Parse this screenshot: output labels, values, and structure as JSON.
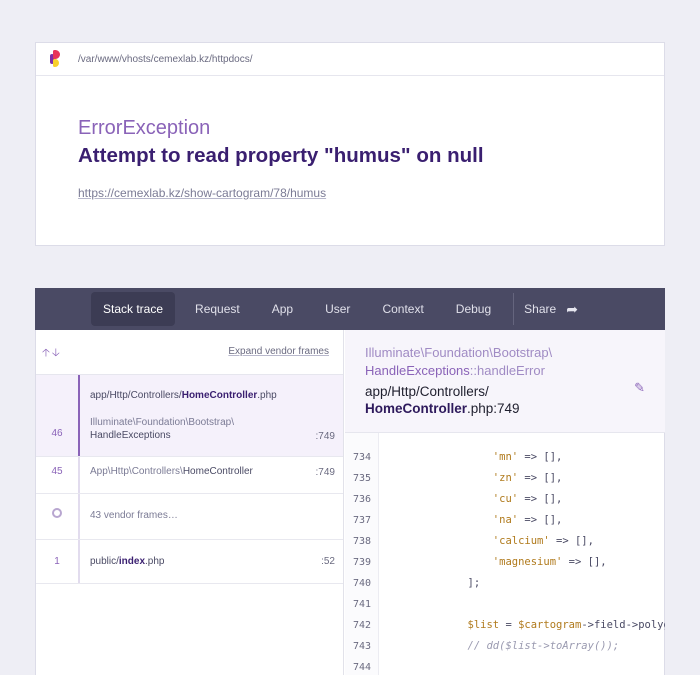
{
  "header": {
    "path": "/var/www/vhosts/cemexlab.kz/httpdocs/"
  },
  "exception": {
    "class": "ErrorException",
    "message": "Attempt to read property \"humus\" on null",
    "url": "https://cemexlab.kz/show-cartogram/78/humus"
  },
  "nav": {
    "items": [
      "Stack trace",
      "Request",
      "App",
      "User",
      "Context",
      "Debug"
    ],
    "active": "Stack trace",
    "share": "Share"
  },
  "stack": {
    "expand_label": "Expand vendor frames",
    "frames": [
      {
        "num": "46",
        "file_prefix": "app/Http/Controllers/",
        "file_strong": "HomeController",
        "file_ext": ".php",
        "sub_line1": "Illuminate\\Foundation\\Bootstrap\\",
        "sub_line2": "HandleExceptions",
        "line": ":749"
      },
      {
        "num": "45",
        "file_prefix": "App\\Http\\Controllers\\",
        "file_strong": "HomeController",
        "line": ":749"
      },
      {
        "vendor_label": "43 vendor frames…"
      },
      {
        "num": "1",
        "file_prefix": "public/",
        "file_strong": "index",
        "file_ext": ".php",
        "line": ":52"
      }
    ]
  },
  "code_header": {
    "class_line1": "Illuminate\\Foundation\\Bootstrap\\",
    "class_line2_a": "HandleExceptions",
    "class_line2_b": "::handleError",
    "file_line1": "app/Http/Controllers/",
    "file_strong": "HomeController",
    "file_ext": ".php:749"
  },
  "code": {
    "lines": [
      {
        "n": "734",
        "indent": "            ",
        "str": "'mn'",
        "rest": " => [],"
      },
      {
        "n": "735",
        "indent": "            ",
        "str": "'zn'",
        "rest": " => [],"
      },
      {
        "n": "736",
        "indent": "            ",
        "str": "'cu'",
        "rest": " => [],"
      },
      {
        "n": "737",
        "indent": "            ",
        "str": "'na'",
        "rest": " => [],"
      },
      {
        "n": "738",
        "indent": "            ",
        "str": "'calcium'",
        "rest": " => [],"
      },
      {
        "n": "739",
        "indent": "            ",
        "str": "'magnesium'",
        "rest": " => [],"
      },
      {
        "n": "740",
        "indent": "        ",
        "str": "",
        "rest": "];"
      },
      {
        "n": "741",
        "indent": "",
        "str": "",
        "rest": ""
      },
      {
        "n": "742",
        "indent": "        ",
        "var1": "$list",
        "op": " = ",
        "var2": "$cartogram",
        "tail": "->field->polygon"
      },
      {
        "n": "743",
        "indent": "        ",
        "comment": "// dd($list->toArray());"
      },
      {
        "n": "744",
        "indent": "",
        "str": "",
        "rest": ""
      }
    ]
  },
  "colors": {
    "accent": "#8a63b8",
    "nav_bg": "#4a4a64",
    "error_title": "#3a1f70"
  }
}
